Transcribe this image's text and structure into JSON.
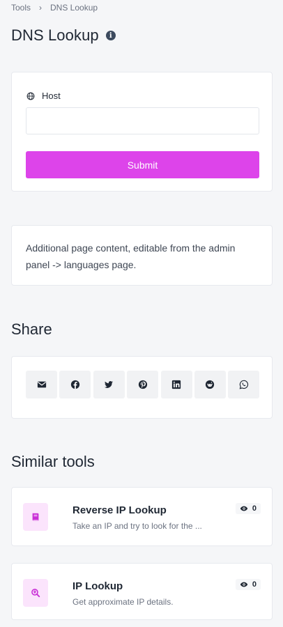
{
  "breadcrumb": {
    "root": "Tools",
    "current": "DNS Lookup"
  },
  "page": {
    "title": "DNS Lookup"
  },
  "form": {
    "host_label": "Host",
    "host_value": "",
    "submit_label": "Submit"
  },
  "content": {
    "text": "Additional page content, editable from the admin panel -> languages page."
  },
  "share": {
    "title": "Share",
    "buttons": [
      "email",
      "facebook",
      "twitter",
      "pinterest",
      "linkedin",
      "reddit",
      "whatsapp"
    ]
  },
  "similar": {
    "title": "Similar tools",
    "tools": [
      {
        "name": "Reverse IP Lookup",
        "description": "Take an IP and try to look for the ...",
        "views": "0",
        "icon": "book-icon"
      },
      {
        "name": "IP Lookup",
        "description": "Get approximate IP details.",
        "views": "0",
        "icon": "search-location-icon"
      }
    ]
  },
  "colors": {
    "accent": "#dd44ea",
    "accent_light": "#fbe4fc",
    "background": "#f5f6f8"
  }
}
